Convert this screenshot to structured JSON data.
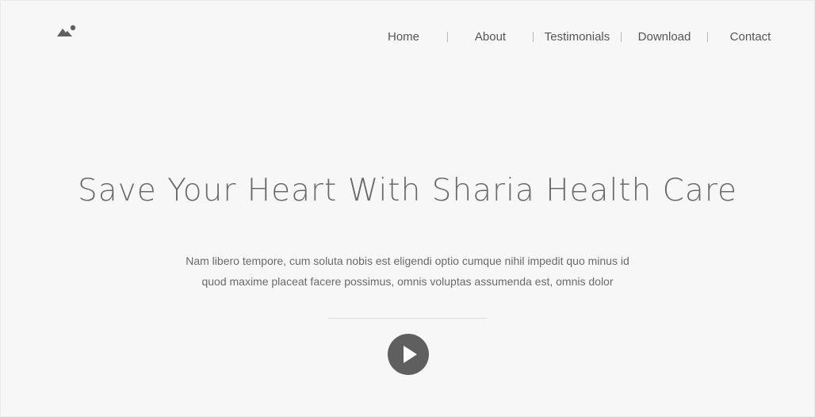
{
  "nav": {
    "items": [
      {
        "label": "Home"
      },
      {
        "label": "About"
      },
      {
        "label": "Testimonials"
      },
      {
        "label": "Download"
      },
      {
        "label": "Contact"
      }
    ]
  },
  "hero": {
    "title": "Save Your Heart With Sharia Health Care",
    "description_line1": "Nam libero tempore, cum soluta nobis est eligendi optio cumque nihil impedit quo minus id",
    "description_line2": "quod maxime placeat facere possimus, omnis voluptas assumenda est, omnis dolor"
  },
  "icons": {
    "logo": "mountain-image-icon",
    "play": "play-icon"
  },
  "colors": {
    "background": "#f7f7f7",
    "text": "#555555",
    "play_button": "#5f5f5f"
  }
}
